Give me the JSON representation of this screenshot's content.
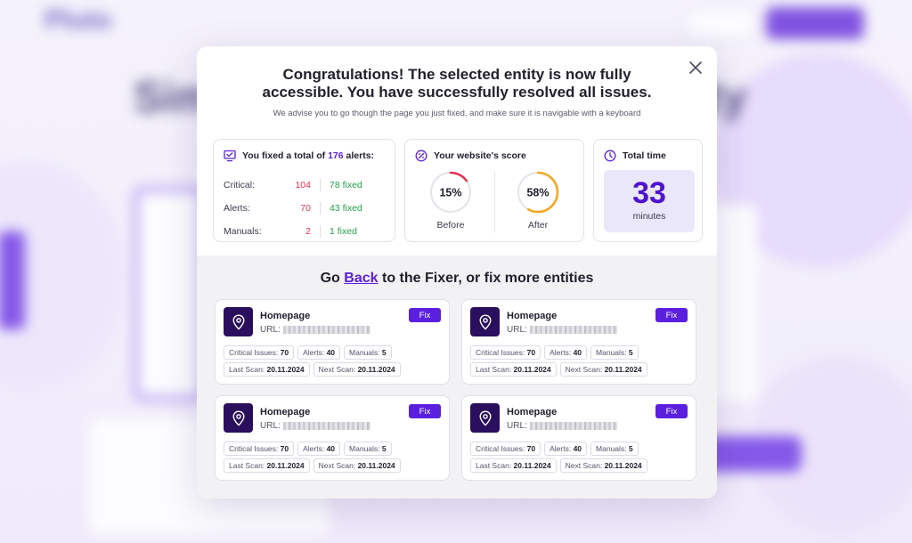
{
  "background": {
    "logo": "Pluto",
    "nav_items": [
      "",
      "",
      "",
      "",
      ""
    ],
    "headline_left": "Sim",
    "headline_right": "ity"
  },
  "modal": {
    "title_line1": "Congratulations! The selected entity is now fully",
    "title_line2": "accessible. You have successfully resolved all issues.",
    "subtitle": "We advise you to go though the page you just fixed, and make sure it is navigable with a keyboard",
    "alerts_card": {
      "title_prefix": "You fixed a total of",
      "total": "176",
      "title_suffix": "alerts:",
      "rows": [
        {
          "label": "Critical:",
          "count": "104",
          "fixed": "78 fixed"
        },
        {
          "label": "Alerts:",
          "count": "70",
          "fixed": "43 fixed"
        },
        {
          "label": "Manuals:",
          "count": "2",
          "fixed": "1 fixed"
        }
      ]
    },
    "score_card": {
      "title": "Your website's score",
      "before": {
        "value": "15%",
        "label": "Before",
        "fraction": 0.15,
        "color": "#e8344d"
      },
      "after": {
        "value": "58%",
        "label": "After",
        "fraction": 0.58,
        "color": "#f5a623"
      }
    },
    "time_card": {
      "title": "Total time",
      "value": "33",
      "unit": "minutes"
    },
    "section": {
      "prefix": "Go",
      "link": "Back",
      "suffix": "to the Fixer, or fix more entities"
    },
    "entities": [
      {
        "name": "Homepage",
        "url_label": "URL:",
        "fix_label": "Fix",
        "critical_label": "Critical Issues:",
        "critical": "70",
        "alerts_label": "Alerts:",
        "alerts": "40",
        "manuals_label": "Manuals:",
        "manuals": "5",
        "last_scan_label": "Last Scan:",
        "last_scan": "20.11.2024",
        "next_scan_label": "Next Scan:",
        "next_scan": "20.11.2024"
      },
      {
        "name": "Homepage",
        "url_label": "URL:",
        "fix_label": "Fix",
        "critical_label": "Critical Issues:",
        "critical": "70",
        "alerts_label": "Alerts:",
        "alerts": "40",
        "manuals_label": "Manuals:",
        "manuals": "5",
        "last_scan_label": "Last Scan:",
        "last_scan": "20.11.2024",
        "next_scan_label": "Next Scan:",
        "next_scan": "20.11.2024"
      },
      {
        "name": "Homepage",
        "url_label": "URL:",
        "fix_label": "Fix",
        "critical_label": "Critical Issues:",
        "critical": "70",
        "alerts_label": "Alerts:",
        "alerts": "40",
        "manuals_label": "Manuals:",
        "manuals": "5",
        "last_scan_label": "Last Scan:",
        "last_scan": "20.11.2024",
        "next_scan_label": "Next Scan:",
        "next_scan": "20.11.2024"
      },
      {
        "name": "Homepage",
        "url_label": "URL:",
        "fix_label": "Fix",
        "critical_label": "Critical Issues:",
        "critical": "70",
        "alerts_label": "Alerts:",
        "alerts": "40",
        "manuals_label": "Manuals:",
        "manuals": "5",
        "last_scan_label": "Last Scan:",
        "last_scan": "20.11.2024",
        "next_scan_label": "Next Scan:",
        "next_scan": "20.11.2024"
      }
    ]
  },
  "colors": {
    "accent": "#5b1fe0",
    "critical": "#e8344d",
    "fixed": "#27a04a",
    "pin_bg": "#2a0f5e"
  },
  "icons": [
    "close-icon",
    "monitor-icon",
    "speed-icon",
    "clock-icon",
    "location-pin-icon"
  ]
}
